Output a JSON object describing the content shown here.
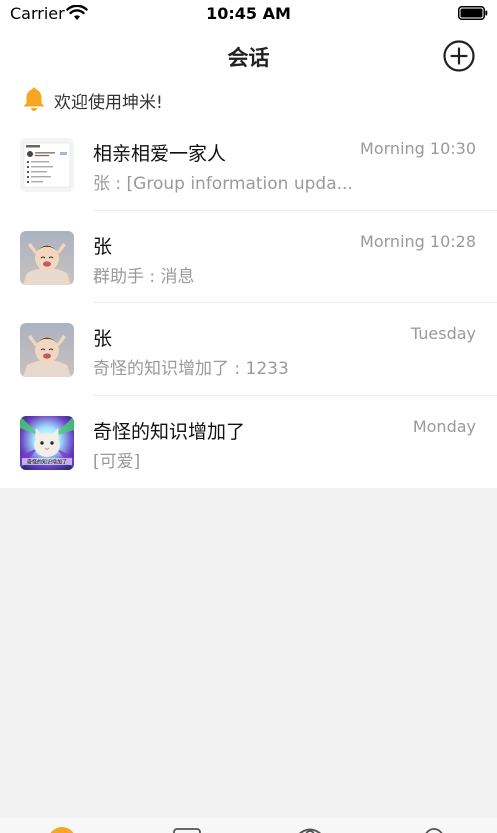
{
  "status_bar": {
    "carrier": "Carrier",
    "time": "10:45 AM"
  },
  "nav": {
    "title": "会话",
    "add_icon": "plus-circle-icon"
  },
  "notice": {
    "icon": "bell-icon",
    "text": "欢迎使用坤米!"
  },
  "conversations": [
    {
      "name": "相亲相爱一家人",
      "preview": "张 : [Group information upda...",
      "time": "Morning 10:30",
      "avatar": "group-screenshot"
    },
    {
      "name": "张",
      "preview": "群助手 : 消息",
      "time": "Morning 10:28",
      "avatar": "baby-photo"
    },
    {
      "name": "张",
      "preview": "奇怪的知识增加了 : 1233",
      "time": "Tuesday",
      "avatar": "baby-photo"
    },
    {
      "name": "奇怪的知识增加了",
      "preview": "[可爱]",
      "time": "Monday",
      "avatar": "cat-meme"
    }
  ],
  "avatar_caption": "奇怪的知识增加了",
  "colors": {
    "accent_orange": "#f5a623",
    "text_primary": "#111111",
    "text_secondary": "#9a9a9a",
    "background": "#f2f2f2"
  }
}
